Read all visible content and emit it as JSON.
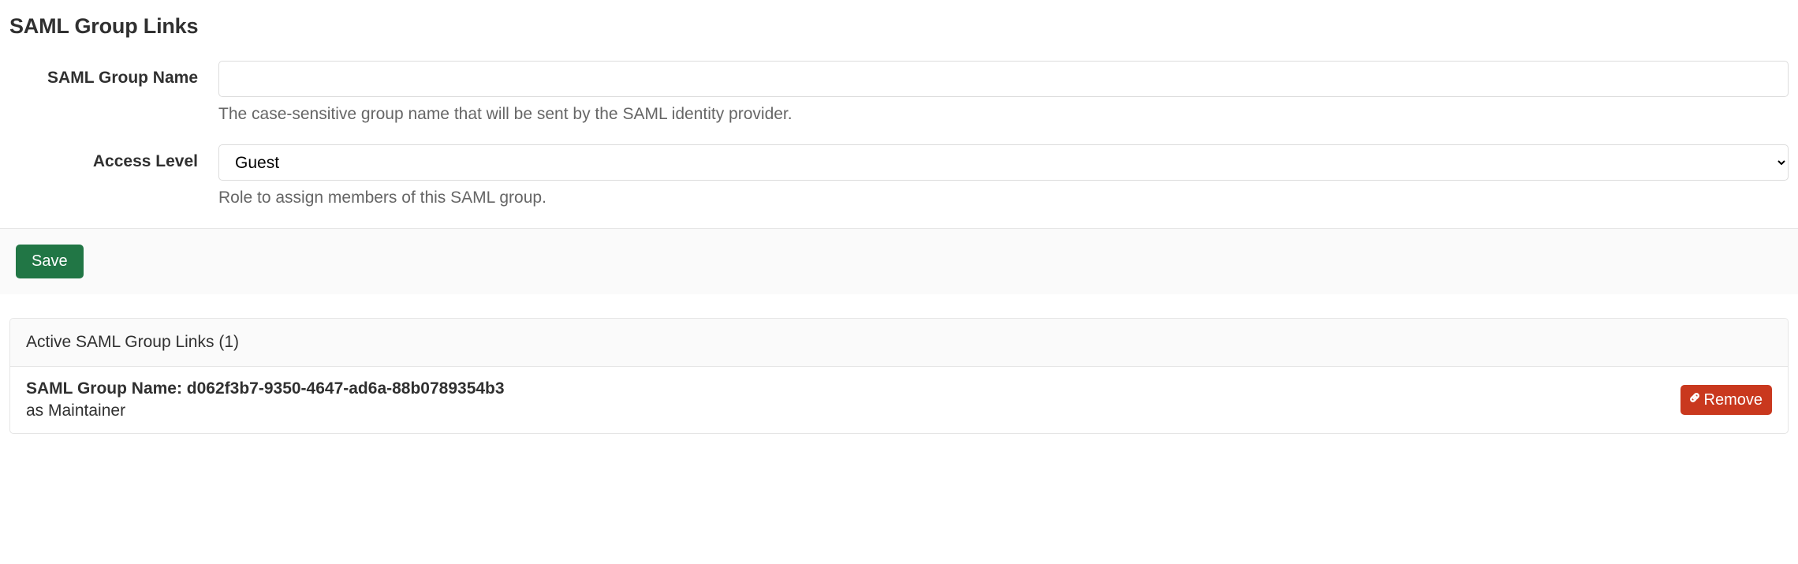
{
  "heading": "SAML Group Links",
  "form": {
    "group_name": {
      "label": "SAML Group Name",
      "value": "",
      "help": "The case-sensitive group name that will be sent by the SAML identity provider."
    },
    "access_level": {
      "label": "Access Level",
      "selected": "Guest",
      "help": "Role to assign members of this SAML group."
    },
    "save_label": "Save"
  },
  "panel": {
    "header": "Active SAML Group Links (1)",
    "items": [
      {
        "title": "SAML Group Name: d062f3b7-9350-4647-ad6a-88b0789354b3",
        "sub": "as Maintainer",
        "remove_label": "Remove"
      }
    ]
  }
}
